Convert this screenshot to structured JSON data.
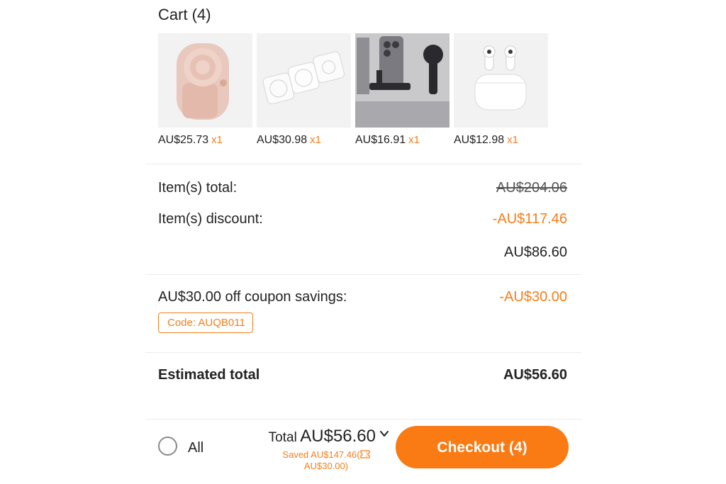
{
  "cart": {
    "title": "Cart (4)",
    "items": [
      {
        "icon": "camera-grip-icon",
        "price": "AU$25.73",
        "qty": "x1"
      },
      {
        "icon": "wireless-charger-icon",
        "price": "AU$30.98",
        "qty": "x1"
      },
      {
        "icon": "laptop-phone-mount-icon",
        "price": "AU$16.91",
        "qty": "x1"
      },
      {
        "icon": "earbuds-case-icon",
        "price": "AU$12.98",
        "qty": "x1"
      }
    ]
  },
  "summary": {
    "items_total_label": "Item(s) total:",
    "items_total_value": "AU$204.06",
    "items_discount_label": "Item(s) discount:",
    "items_discount_value": "-AU$117.46",
    "subtotal_value": "AU$86.60",
    "coupon_label": "AU$30.00 off coupon savings:",
    "coupon_value": "-AU$30.00",
    "coupon_code": "Code: AUQB011",
    "estimated_label": "Estimated total",
    "estimated_value": "AU$56.60"
  },
  "footer": {
    "select_all_label": "All",
    "total_prefix": "Total",
    "total_amount": "AU$56.60",
    "saved_line1": "Saved AU$147.46(",
    "saved_line2": "AU$30.00)",
    "checkout_label": "Checkout (4)"
  },
  "colors": {
    "accent": "#f77e1a",
    "button": "#fa7a14",
    "text": "#222222",
    "thumb_bg": "#f2f2f2"
  }
}
